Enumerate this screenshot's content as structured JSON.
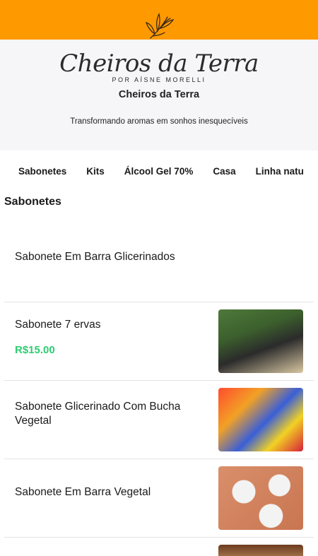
{
  "brand": {
    "logo_script": "Cheiros da Terra",
    "logo_sub": "POR AÍSNE MORELLI",
    "store_name": "Cheiros da Terra",
    "tagline": "Transformando aromas em sonhos inesquecíveis",
    "accent_color": "#ff9900",
    "logo_icon": "leaf-sprig-icon"
  },
  "categories": [
    {
      "label": "Sabonetes"
    },
    {
      "label": "Kits"
    },
    {
      "label": "Álcool Gel 70%"
    },
    {
      "label": "Casa"
    },
    {
      "label": "Linha natu"
    }
  ],
  "section": {
    "title": "Sabonetes"
  },
  "products": [
    {
      "name": "Sabonete Em Barra Glicerinados",
      "price": ""
    },
    {
      "name": "Sabonete 7 ervas",
      "price": "R$15.00",
      "image": "herbal-soap-photo"
    },
    {
      "name": "Sabonete Glicerinado Com Bucha Vegetal",
      "price": "",
      "image": "loofah-soap-photo"
    },
    {
      "name": "Sabonete Em Barra Vegetal",
      "price": "",
      "image": "vegetal-soap-photo"
    },
    {
      "name": "",
      "price": "",
      "image": "product-photo"
    }
  ],
  "price_color": "#2ecc71"
}
